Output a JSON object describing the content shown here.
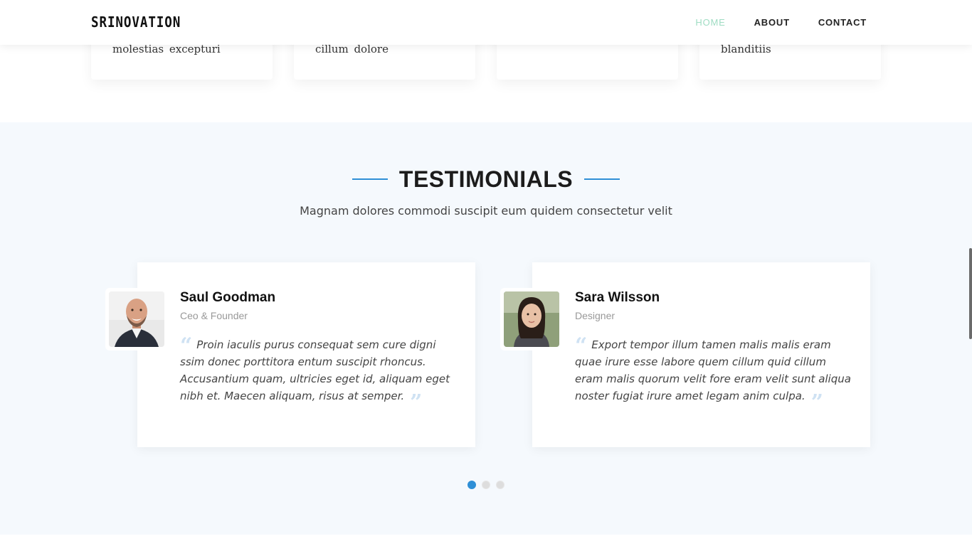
{
  "header": {
    "logo": "SRINOVATION",
    "nav": [
      {
        "label": "HOME",
        "active": true
      },
      {
        "label": "ABOUT",
        "active": false
      },
      {
        "label": "CONTACT",
        "active": false
      }
    ]
  },
  "top_cards": [
    {
      "text": "molestias  excepturi"
    },
    {
      "text": "cillum  dolore"
    },
    {
      "text": ""
    },
    {
      "text": "blanditiis"
    }
  ],
  "testimonials": {
    "title": "TESTIMONIALS",
    "subtitle": "Magnam dolores commodi suscipit eum quidem consectetur velit",
    "items": [
      {
        "name": "Saul Goodman",
        "role": "Ceo & Founder",
        "quote": "Proin iaculis purus consequat sem cure digni ssim donec porttitora entum suscipit rhoncus. Accusantium quam, ultricies eget id, aliquam eget nibh et. Maecen aliquam, risus at semper."
      },
      {
        "name": "Sara Wilsson",
        "role": "Designer",
        "quote": "Export tempor illum tamen malis malis eram quae irure esse labore quem cillum quid cillum eram malis quorum velit fore eram velit sunt aliqua noster fugiat irure amet legam anim culpa."
      }
    ],
    "pagination": {
      "count": 3,
      "active_index": 0
    }
  },
  "colors": {
    "accent": "#2f8fd6",
    "nav_active": "#9fdcc3",
    "section_bg": "#f5f9fd",
    "quote_mark": "#cfe2f3"
  },
  "icons": [
    "quote-open-icon",
    "quote-close-icon"
  ]
}
